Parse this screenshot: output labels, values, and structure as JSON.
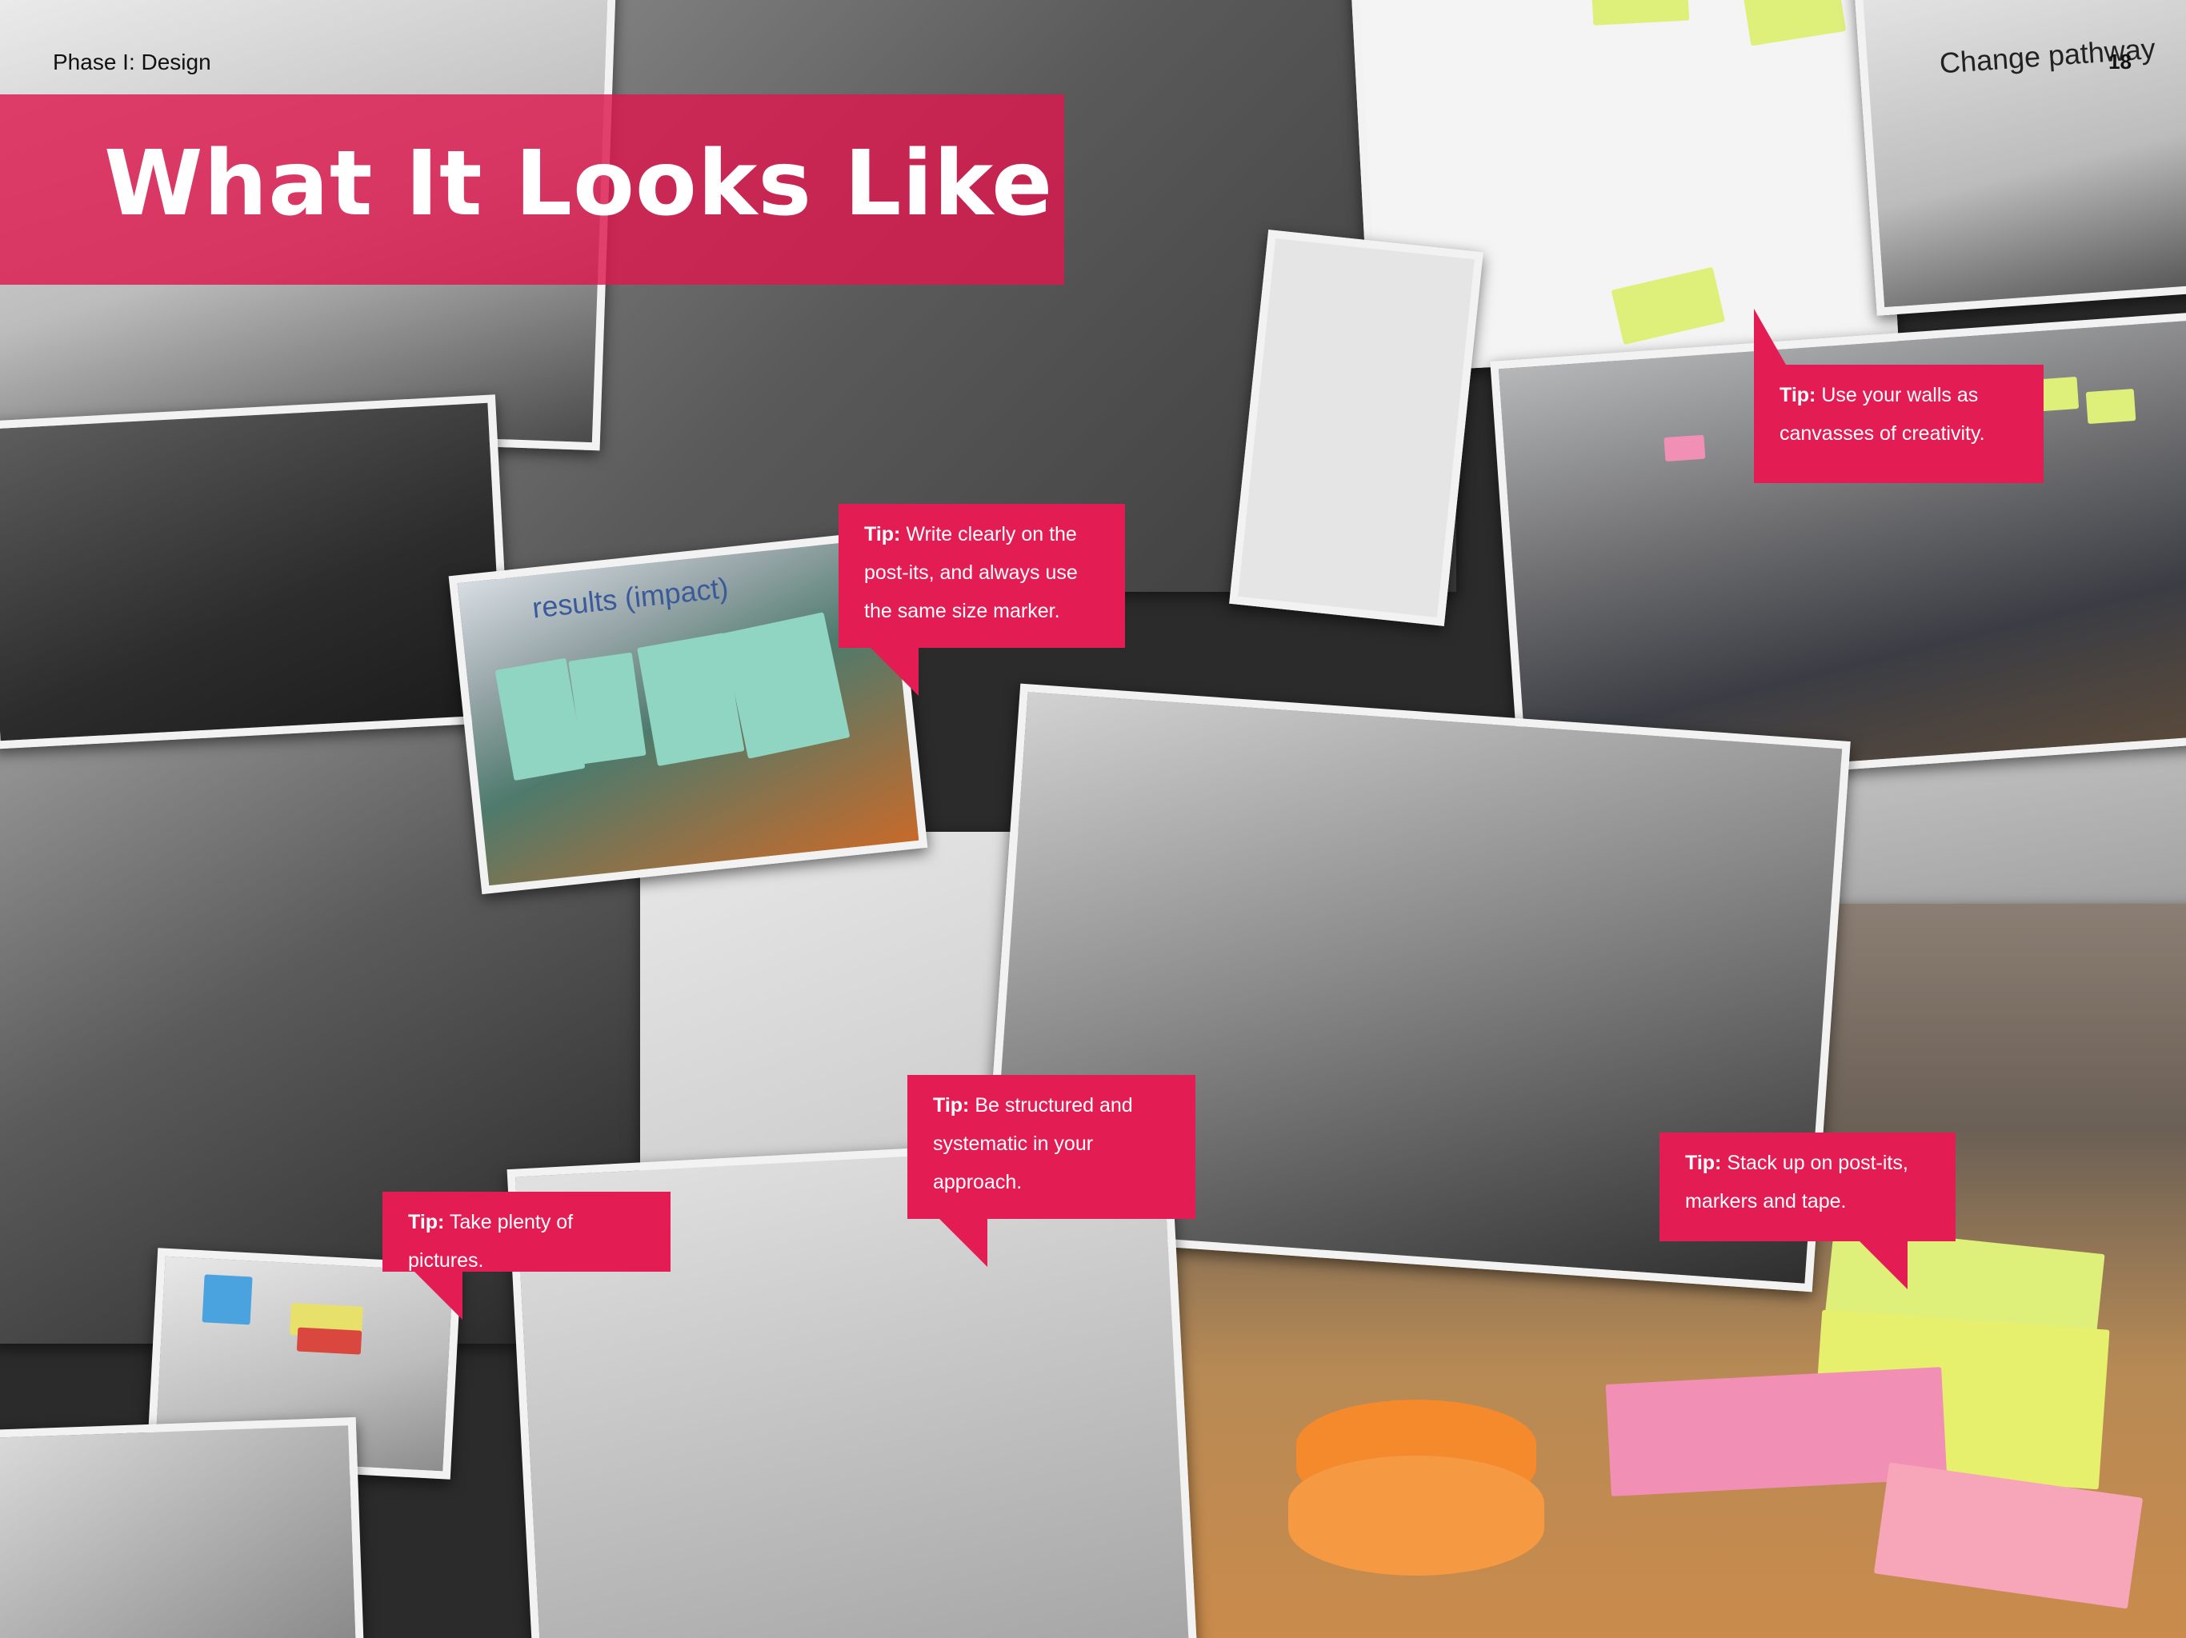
{
  "page": {
    "section_label": "Phase I: Design",
    "page_number": "18",
    "title": "What It Looks Like"
  },
  "tips": [
    {
      "prefix": "Tip:",
      "text": " Write clearly on the post-its, and always use the same size marker."
    },
    {
      "prefix": "Tip:",
      "text": " Use your walls as canvasses of creativity."
    },
    {
      "prefix": "Tip:",
      "text": " Take plenty of pictures."
    },
    {
      "prefix": "Tip:",
      "text": " Be structured and systematic in your approach."
    },
    {
      "prefix": "Tip:",
      "text": " Stack up on post-its, markers and tape."
    }
  ],
  "photo_text": {
    "slide_title": "Change pathway",
    "screen_banner": "results (impact)"
  },
  "colors": {
    "accent": "#e31c54",
    "band": "#de184e",
    "photo_border": "#f2f2f2"
  }
}
